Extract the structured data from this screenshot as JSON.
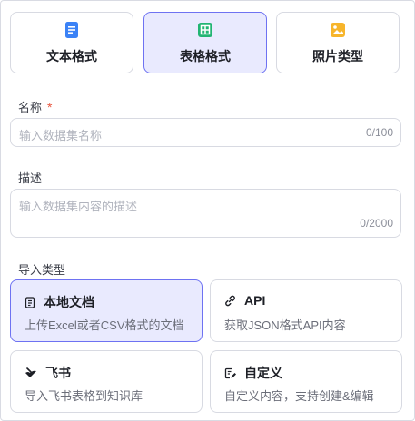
{
  "format_tabs": [
    {
      "label": "文本格式",
      "icon": "document-icon",
      "color": "#3b82f6"
    },
    {
      "label": "表格格式",
      "icon": "table-icon",
      "color": "#22b573"
    },
    {
      "label": "照片类型",
      "icon": "image-icon",
      "color": "#f7b52b"
    }
  ],
  "active_tab": "表格格式",
  "name_field": {
    "label": "名称",
    "required_mark": "*",
    "placeholder": "输入数据集名称",
    "counter": "0/100"
  },
  "desc_field": {
    "label": "描述",
    "placeholder": "输入数据集内容的描述",
    "counter": "0/2000"
  },
  "import_type": {
    "label": "导入类型",
    "options": [
      {
        "title": "本地文档",
        "desc": "上传Excel或者CSV格式的文档",
        "icon": "file-icon"
      },
      {
        "title": "API",
        "desc": "获取JSON格式API内容",
        "icon": "link-icon"
      },
      {
        "title": "飞书",
        "desc": "导入飞书表格到知识库",
        "icon": "feishu-icon"
      },
      {
        "title": "自定义",
        "desc": "自定义内容，支持创建&编辑",
        "icon": "edit-icon"
      }
    ],
    "selected": "本地文档"
  },
  "colors": {
    "accent": "#6e72f2",
    "accent_bg": "#e9eafe",
    "border": "#d8dae2",
    "required": "#e8553e"
  }
}
